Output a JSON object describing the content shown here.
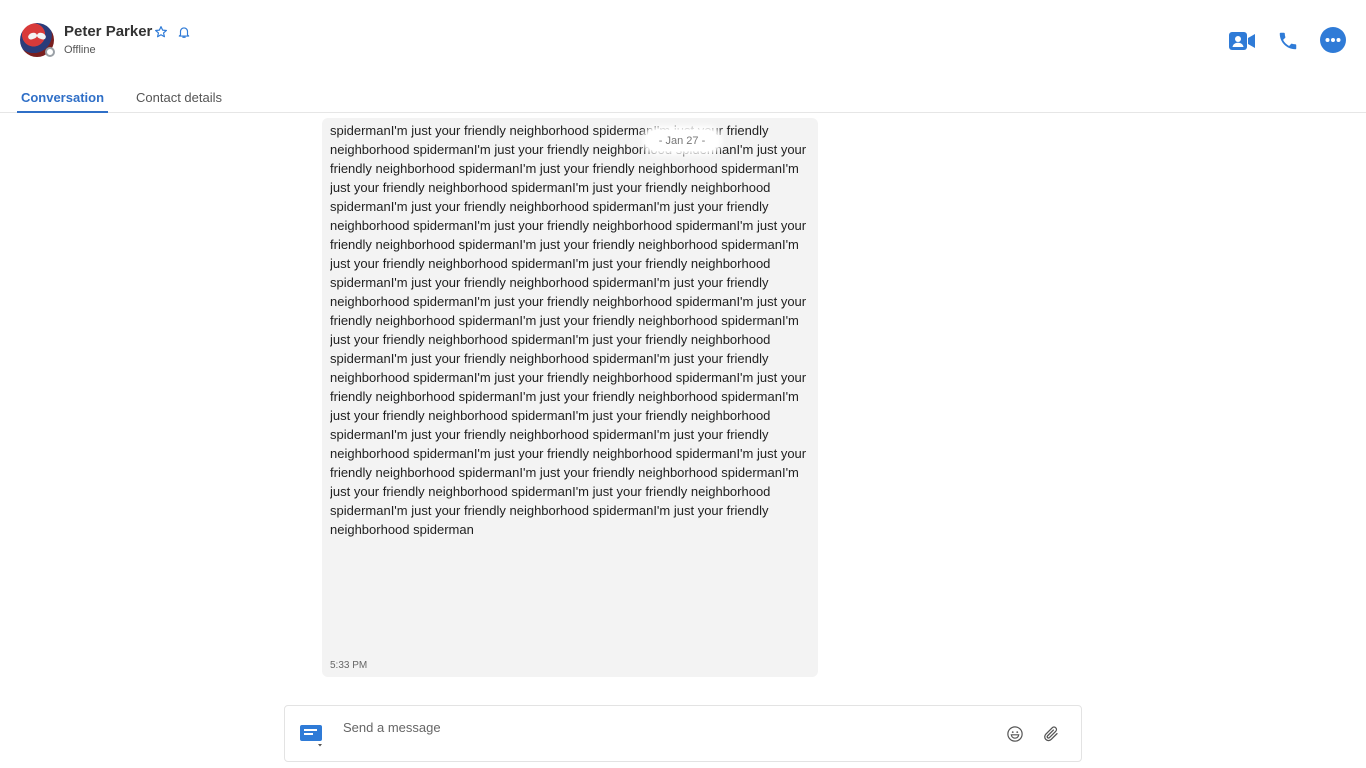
{
  "contact": {
    "name": "Peter Parker",
    "status": "Offline"
  },
  "header_icons": {
    "favorite": "star-icon",
    "notifications": "bell-icon",
    "video_call": "video-camera-icon",
    "voice_call": "phone-icon",
    "more": "more-icon"
  },
  "tabs": [
    {
      "label": "Conversation",
      "active": true
    },
    {
      "label": "Contact details",
      "active": false
    }
  ],
  "date_separator": "- Jan 27 -",
  "message": {
    "text": "spidermanI'm just your friendly neighborhood spidermanI'm just your friendly neighborhood spidermanI'm just your friendly neighborhood spidermanI'm just your friendly neighborhood spidermanI'm just your friendly neighborhood spidermanI'm just your friendly neighborhood spidermanI'm just your friendly neighborhood spidermanI'm just your friendly neighborhood spidermanI'm just your friendly neighborhood spidermanI'm just your friendly neighborhood spidermanI'm just your friendly neighborhood spidermanI'm just your friendly neighborhood spidermanI'm just your friendly neighborhood spidermanI'm just your friendly neighborhood spidermanI'm just your friendly neighborhood spidermanI'm just your friendly neighborhood spidermanI'm just your friendly neighborhood spidermanI'm just your friendly neighborhood spidermanI'm just your friendly neighborhood spidermanI'm just your friendly neighborhood spidermanI'm just your friendly neighborhood spidermanI'm just your friendly neighborhood spidermanI'm just your friendly neighborhood spidermanI'm just your friendly neighborhood spidermanI'm just your friendly neighborhood spidermanI'm just your friendly neighborhood spidermanI'm just your friendly neighborhood spidermanI'm just your friendly neighborhood spidermanI'm just your friendly neighborhood spidermanI'm just your friendly neighborhood spidermanI'm just your friendly neighborhood spidermanI'm just your friendly neighborhood spidermanI'm just your friendly neighborhood spidermanI'm just your friendly neighborhood spidermanI'm just your friendly neighborhood spidermanI'm just your friendly neighborhood spidermanI'm just your friendly neighborhood spiderman",
    "time": "5:33 PM"
  },
  "composer": {
    "placeholder": "Send a message",
    "value": "",
    "compose_icon": "message-type-icon",
    "emoji_icon": "emoji-icon",
    "attach_icon": "paperclip-icon"
  },
  "colors": {
    "accent": "#2f7bd7",
    "tab_active": "#2f6fc7",
    "bubble": "#f3f3f3"
  }
}
